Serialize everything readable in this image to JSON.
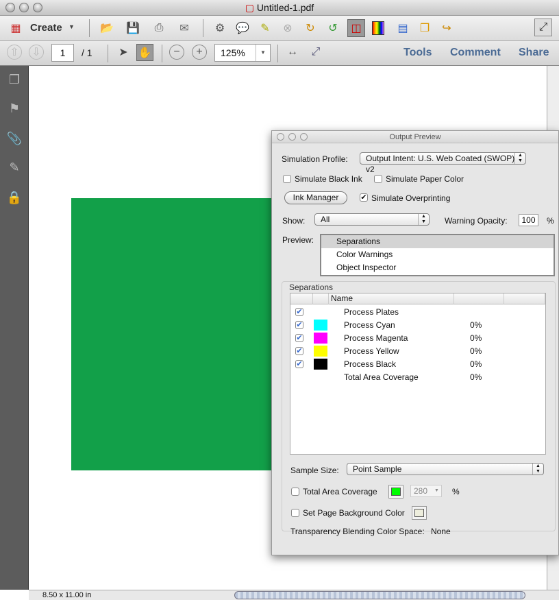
{
  "window": {
    "title": "Untitled-1.pdf"
  },
  "toolbar": {
    "create_label": "Create",
    "page_current": "1",
    "page_total": "/ 1",
    "zoom": "125%",
    "tools": "Tools",
    "comment": "Comment",
    "share": "Share"
  },
  "status": {
    "page_size": "8.50 x 11.00 in"
  },
  "colors": {
    "page_object": "#12a049",
    "cyan": "#00ffff",
    "magenta": "#ff00ff",
    "yellow": "#ffff00",
    "black": "#000000",
    "tac_swatch": "#00ff00",
    "bg_swatch": "#eeeedd"
  },
  "dialog": {
    "title": "Output Preview",
    "simulation_profile_label": "Simulation Profile:",
    "simulation_profile_value": "Output Intent: U.S. Web Coated (SWOP) v2",
    "simulate_black_ink": "Simulate Black Ink",
    "simulate_paper_color": "Simulate Paper Color",
    "ink_manager": "Ink Manager",
    "simulate_overprinting": "Simulate Overprinting",
    "show_label": "Show:",
    "show_value": "All",
    "warning_opacity_label": "Warning Opacity:",
    "warning_opacity_value": "100",
    "percent": "%",
    "preview_label": "Preview:",
    "preview_options": [
      "Separations",
      "Color Warnings",
      "Object Inspector"
    ],
    "separations_label": "Separations",
    "table_header": "Name",
    "rows": [
      {
        "name": "Process Plates",
        "value": ""
      },
      {
        "name": "Process Cyan",
        "value": "0%"
      },
      {
        "name": "Process Magenta",
        "value": "0%"
      },
      {
        "name": "Process Yellow",
        "value": "0%"
      },
      {
        "name": "Process Black",
        "value": "0%"
      },
      {
        "name": "Total Area Coverage",
        "value": "0%"
      }
    ],
    "sample_size_label": "Sample Size:",
    "sample_size_value": "Point Sample",
    "total_area_coverage": "Total Area Coverage",
    "tac_value": "280",
    "set_page_bg": "Set Page Background Color",
    "tbcs_label": "Transparency Blending Color Space:",
    "tbcs_value": "None"
  }
}
